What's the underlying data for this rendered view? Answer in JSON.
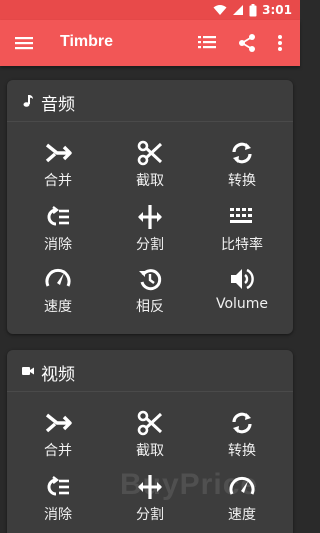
{
  "status_bar": {
    "time": "3:01"
  },
  "app_bar": {
    "title": "Timbre"
  },
  "colors": {
    "app_bar": "#f25656",
    "status_bar": "#e84a4a",
    "background": "#2a2a2a",
    "card": "#3d3d3d"
  },
  "audio": {
    "title": "音频",
    "icon": "music-note-icon",
    "tools": [
      {
        "label": "合并",
        "icon": "merge-icon"
      },
      {
        "label": "截取",
        "icon": "scissors-icon"
      },
      {
        "label": "转换",
        "icon": "convert-icon"
      },
      {
        "label": "消除",
        "icon": "remove-icon"
      },
      {
        "label": "分割",
        "icon": "split-icon"
      },
      {
        "label": "比特率",
        "icon": "bitrate-icon"
      },
      {
        "label": "速度",
        "icon": "speed-icon"
      },
      {
        "label": "相反",
        "icon": "reverse-icon"
      },
      {
        "label": "Volume",
        "icon": "volume-icon"
      }
    ]
  },
  "video": {
    "title": "视频",
    "icon": "video-camera-icon",
    "tools": [
      {
        "label": "合并",
        "icon": "merge-icon"
      },
      {
        "label": "截取",
        "icon": "scissors-icon"
      },
      {
        "label": "转换",
        "icon": "convert-icon"
      },
      {
        "label": "消除",
        "icon": "remove-icon"
      },
      {
        "label": "分割",
        "icon": "split-icon"
      },
      {
        "label": "速度",
        "icon": "speed-icon"
      }
    ]
  },
  "watermark": "BuyPrice"
}
